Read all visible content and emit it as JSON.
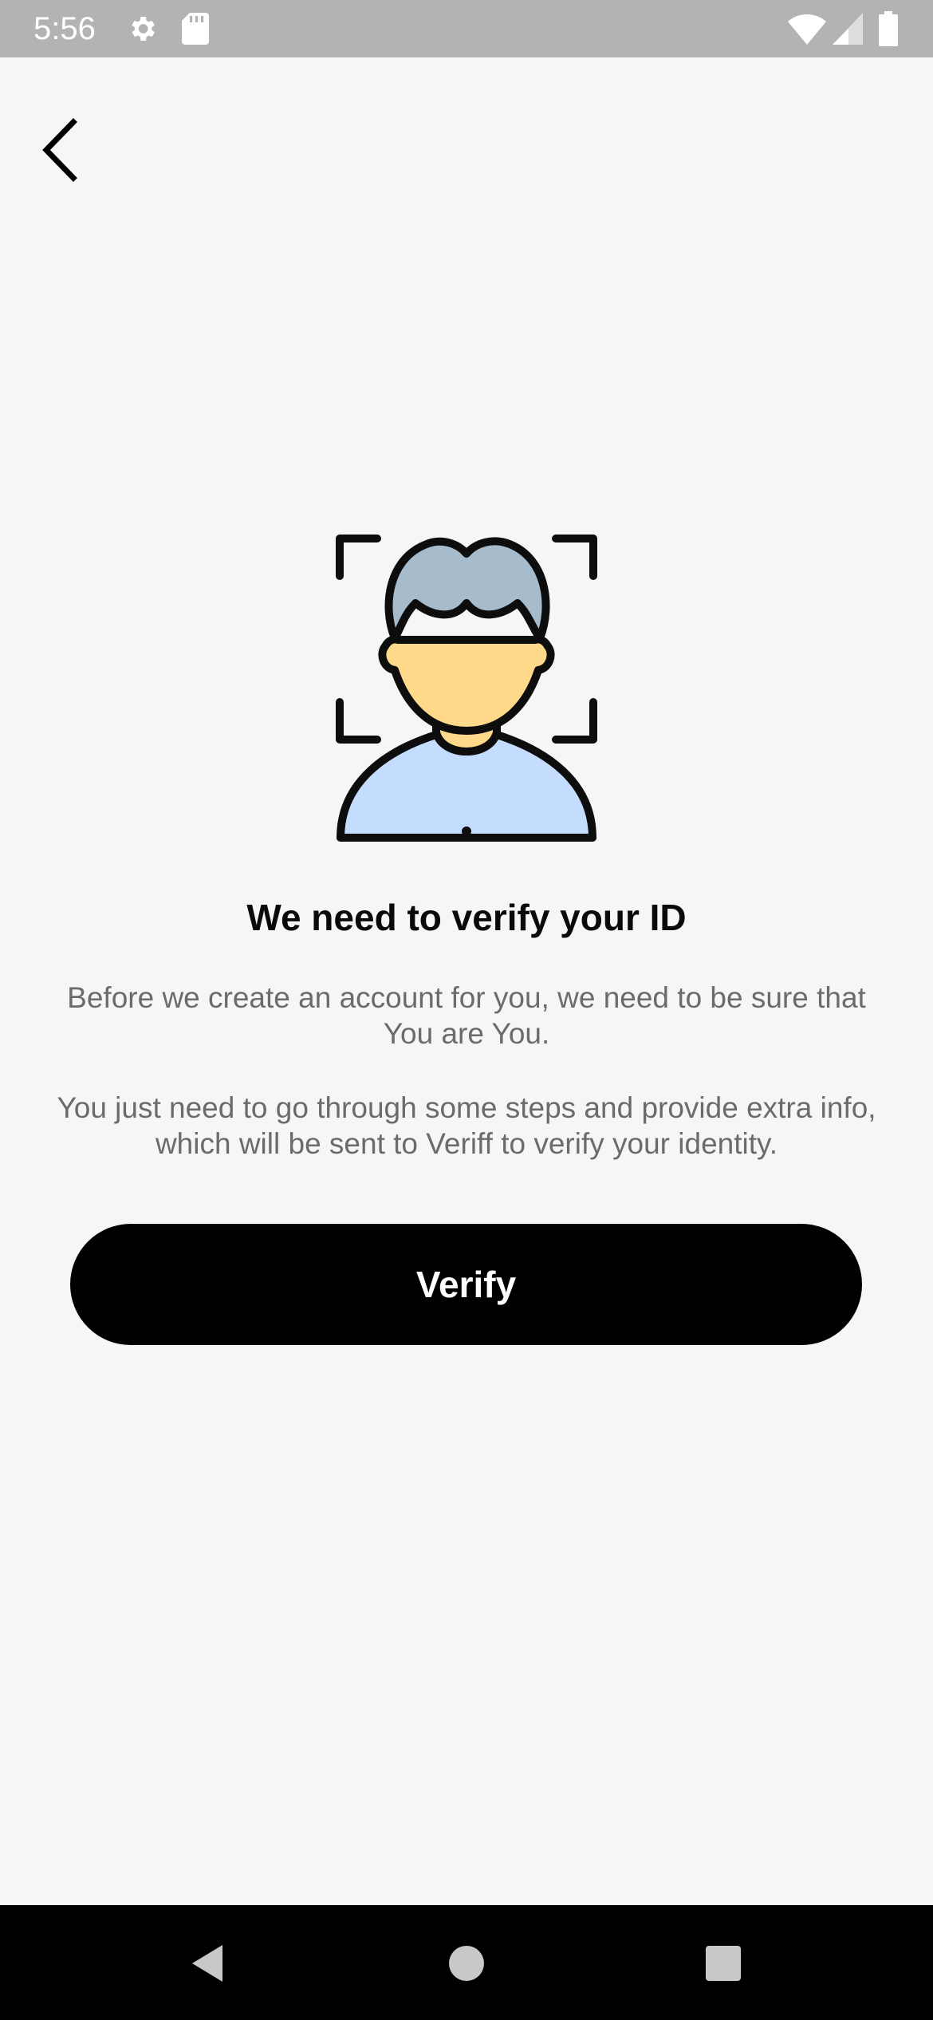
{
  "status_bar": {
    "time": "5:56",
    "left_icons": [
      "gear-icon",
      "sd-card-icon"
    ],
    "right_icons": [
      "wifi-icon",
      "cell-signal-icon",
      "battery-icon"
    ]
  },
  "header": {
    "back_icon": "chevron-left-icon"
  },
  "illustration": {
    "icon": "face-id-person-icon",
    "colors": {
      "hair": "#a6bccd",
      "face": "#ffd98a",
      "shirt": "#c4ddff",
      "outline": "#0d0d0d"
    }
  },
  "content": {
    "title": "We need to verify your ID",
    "paragraph_1": "Before we create an account for you, we need to be sure that You are You.",
    "paragraph_2": "You just need to go through some steps and provide extra info, which will be sent to Veriff to verify your identity."
  },
  "actions": {
    "verify_label": "Verify"
  },
  "navigation_bar": {
    "buttons": [
      "back-triangle-icon",
      "home-circle-icon",
      "recents-square-icon"
    ]
  },
  "colors": {
    "background": "#f6f6f6",
    "status_bar": "#b3b3b3",
    "primary_button": "#000000",
    "title_text": "#0a0a0a",
    "body_text": "#6b6b6b"
  }
}
